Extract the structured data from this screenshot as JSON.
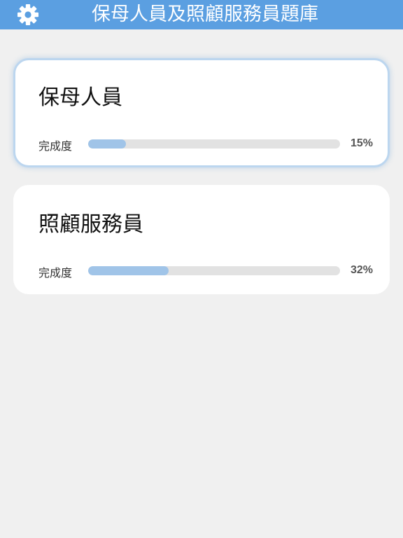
{
  "header": {
    "title": "保母人員及照顧服務員題庫",
    "settings_icon": "gear-icon",
    "background_color": "#5b9fe1"
  },
  "cards": [
    {
      "title": "保母人員",
      "progress_label": "完成度",
      "progress_value": "15%",
      "progress_fraction": 0.15,
      "selected": true
    },
    {
      "title": "照顧服務員",
      "progress_label": "完成度",
      "progress_value": "32%",
      "progress_fraction": 0.32,
      "selected": false
    }
  ],
  "colors": {
    "progress_fill": "#a0c4e8",
    "progress_track": "#e2e2e2",
    "background": "#f0f0f0"
  }
}
